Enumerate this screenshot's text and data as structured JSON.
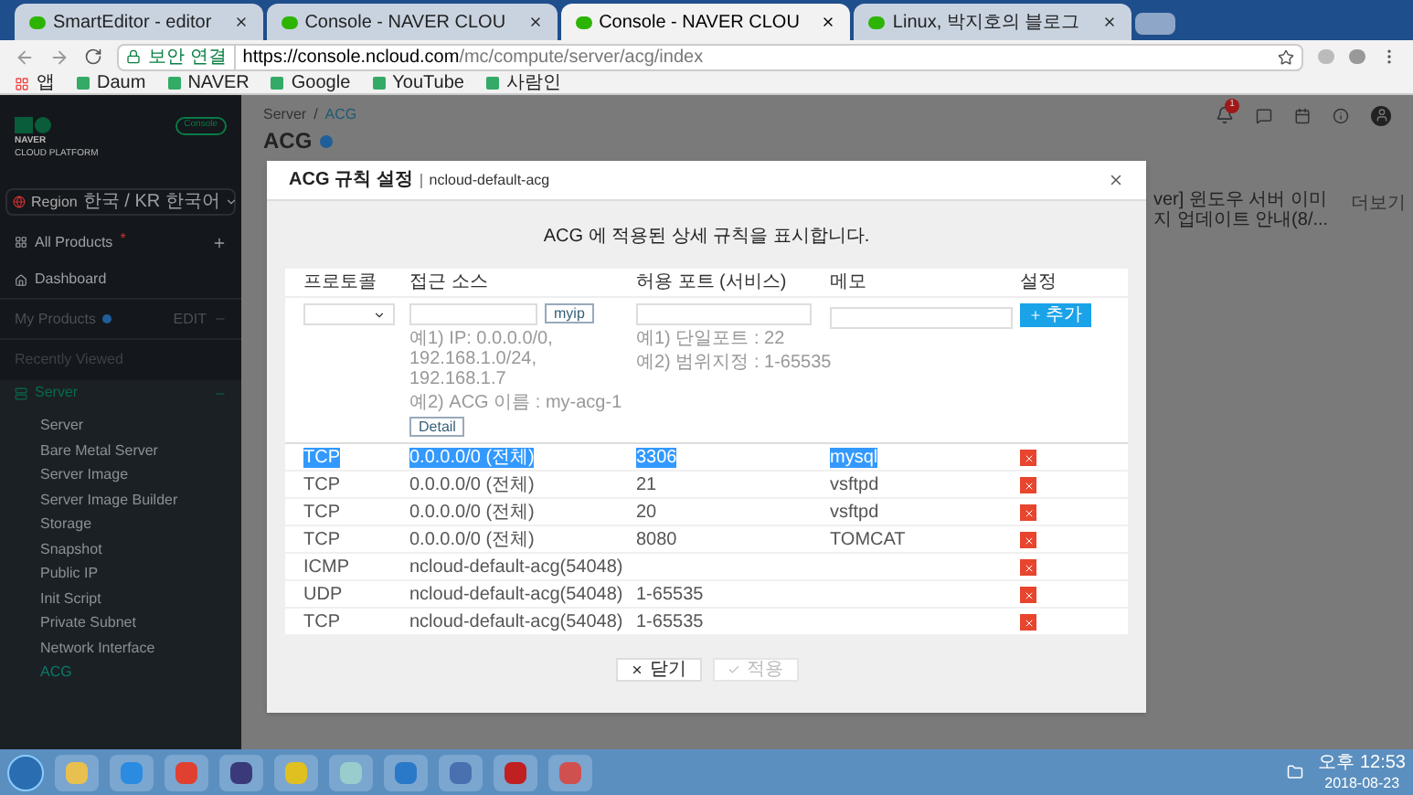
{
  "browser": {
    "tabs": [
      {
        "title": "SmartEditor - editor",
        "selected": false
      },
      {
        "title": "Console - NAVER CLOU",
        "selected": false
      },
      {
        "title": "Console - NAVER CLOU",
        "selected": true
      },
      {
        "title": "Linux, 박지호의 블로그",
        "selected": false
      }
    ],
    "security": "보안 연결",
    "url_host": "https://console.ncloud.com",
    "url_path": "/mc/compute/server/acg/index",
    "bookmarks": [
      "앱",
      "Daum",
      "NAVER",
      "Google",
      "YouTube",
      "사람인"
    ]
  },
  "sidebar": {
    "logo_top": "NAVER",
    "logo_bottom": "CLOUD PLATFORM",
    "badge": "Console",
    "region_label": "Region",
    "region_value": "한국 / KR 한국어",
    "all_products": "All Products",
    "all_products_marker": "*",
    "dashboard": "Dashboard",
    "my_products": "My Products",
    "edit": "EDIT",
    "recently_viewed": "Recently Viewed",
    "group": {
      "label": "Server",
      "expanded": true,
      "children": [
        {
          "label": "Server",
          "selected": false
        },
        {
          "label": "Bare Metal Server",
          "selected": false
        },
        {
          "label": "Server Image",
          "selected": false
        },
        {
          "label": "Server Image Builder",
          "selected": false
        },
        {
          "label": "Storage",
          "selected": false
        },
        {
          "label": "Snapshot",
          "selected": false
        },
        {
          "label": "Public IP",
          "selected": false
        },
        {
          "label": "Init Script",
          "selected": false
        },
        {
          "label": "Private Subnet",
          "selected": false
        },
        {
          "label": "Network Interface",
          "selected": false
        },
        {
          "label": "ACG",
          "selected": true
        }
      ]
    }
  },
  "page": {
    "breadcrumb": [
      "Server",
      "ACG"
    ],
    "breadcrumb_separator": "/",
    "title": "ACG",
    "notification_count": "1",
    "notice": "ver] 윈도우 서버 이미지 업데이트 안내(8/...",
    "notice_more": "더보기"
  },
  "modal": {
    "title": "ACG 규칙 설정",
    "subtitle": "ncloud-default-acg",
    "description": "ACG 에 적용된 상세 규칙을 표시합니다.",
    "columns": [
      "프로토콜",
      "접근 소스",
      "허용 포트 (서비스)",
      "메모",
      "설정"
    ],
    "myip": "myip",
    "source_hints": [
      "예1) IP: 0.0.0.0/0, 192.168.1.0/24, 192.168.1.7",
      "예2) ACG 이름 : my-acg-1"
    ],
    "detail": "Detail",
    "port_hints": [
      "예1) 단일포트 : 22",
      "예2) 범위지정 : 1-65535"
    ],
    "add": "추가",
    "rows": [
      {
        "protocol": "TCP",
        "source": "0.0.0.0/0 (전체)",
        "port": "3306",
        "memo": "mysql",
        "selected": true
      },
      {
        "protocol": "TCP",
        "source": "0.0.0.0/0 (전체)",
        "port": "21",
        "memo": "vsftpd",
        "selected": false
      },
      {
        "protocol": "TCP",
        "source": "0.0.0.0/0 (전체)",
        "port": "20",
        "memo": "vsftpd",
        "selected": false
      },
      {
        "protocol": "TCP",
        "source": "0.0.0.0/0 (전체)",
        "port": "8080",
        "memo": "TOMCAT",
        "selected": false
      },
      {
        "protocol": "ICMP",
        "source": "ncloud-default-acg(54048)",
        "selected": false
      },
      {
        "protocol": "UDP",
        "source": "ncloud-default-acg(54048)",
        "port": "1-65535",
        "selected": false
      },
      {
        "protocol": "TCP",
        "source": "ncloud-default-acg(54048)",
        "port": "1-65535",
        "selected": false
      }
    ],
    "close": {
      "label": "닫기",
      "disabled": false
    },
    "apply": {
      "label": "적용",
      "disabled": true
    }
  },
  "taskbar": {
    "time": "오후 12:53",
    "date": "2018-08-23"
  }
}
